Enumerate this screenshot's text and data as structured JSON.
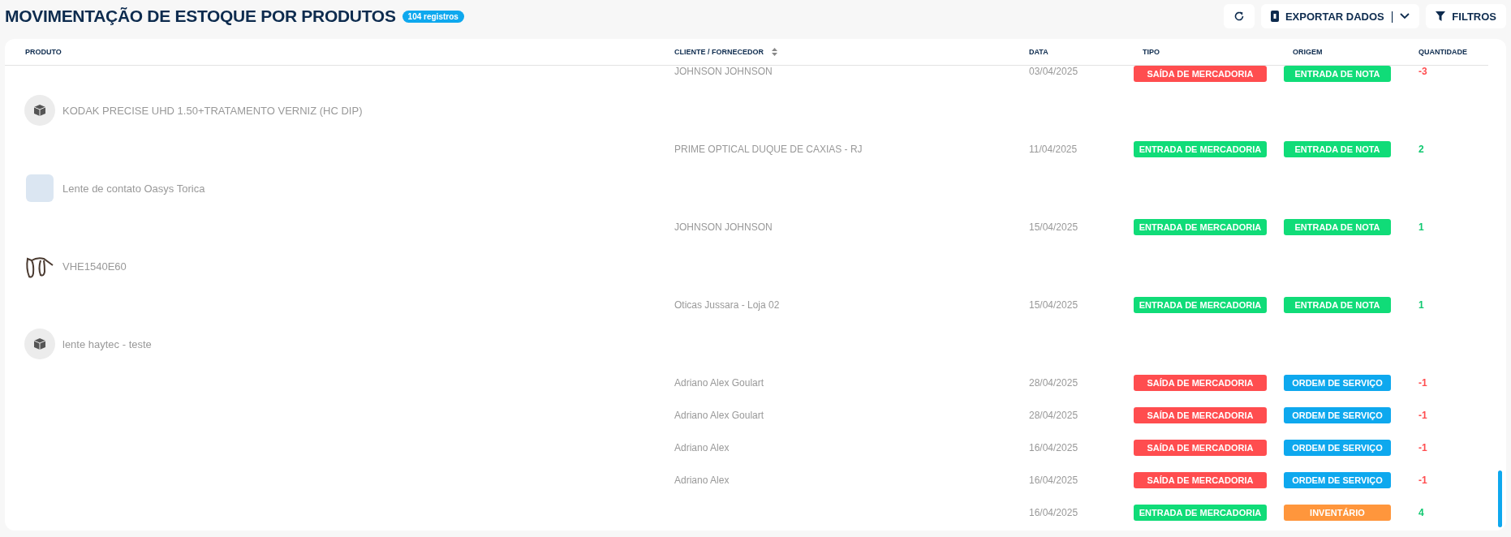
{
  "header": {
    "title": "MOVIMENTAÇÃO DE ESTOQUE POR PRODUTOS",
    "count_badge": "104 registros",
    "export_button": "EXPORTAR DADOS",
    "separator": "|",
    "filter_button": "FILTROS"
  },
  "table": {
    "columns": [
      "PRODUTO",
      "CLIENTE / FORNECEDOR",
      "DATA",
      "TIPO",
      "ORIGEM",
      "QUANTIDADE"
    ],
    "rows": [
      {
        "kind": "movement",
        "client": "JOHNSON JOHNSON",
        "date": "03/04/2025",
        "type": {
          "label": "SAÍDA DE MERCADORIA",
          "kind": "out"
        },
        "origin": {
          "label": "ENTRADA DE NOTA",
          "kind": "nota"
        },
        "quantity": "-3"
      },
      {
        "kind": "box",
        "name": "KODAK PRECISE UHD 1.50+TRATAMENTO VERNIZ (HC DIP)"
      },
      {
        "kind": "movement",
        "client": "PRIME OPTICAL DUQUE DE CAXIAS - RJ",
        "date": "11/04/2025",
        "type": {
          "label": "ENTRADA DE MERCADORIA",
          "kind": "in"
        },
        "origin": {
          "label": "ENTRADA DE NOTA",
          "kind": "nota"
        },
        "quantity": "2"
      },
      {
        "kind": "photo",
        "name": "Lente de contato Oasys Torica"
      },
      {
        "kind": "movement",
        "client": "JOHNSON JOHNSON",
        "date": "15/04/2025",
        "type": {
          "label": "ENTRADA DE MERCADORIA",
          "kind": "in"
        },
        "origin": {
          "label": "ENTRADA DE NOTA",
          "kind": "nota"
        },
        "quantity": "1"
      },
      {
        "kind": "glasses",
        "name": "VHE1540E60"
      },
      {
        "kind": "movement",
        "client": "Oticas Jussara - Loja 02",
        "date": "15/04/2025",
        "type": {
          "label": "ENTRADA DE MERCADORIA",
          "kind": "in"
        },
        "origin": {
          "label": "ENTRADA DE NOTA",
          "kind": "nota"
        },
        "quantity": "1"
      },
      {
        "kind": "box",
        "name": "lente haytec - teste"
      },
      {
        "kind": "movement",
        "client": "Adriano Alex Goulart",
        "date": "28/04/2025",
        "type": {
          "label": "SAÍDA DE MERCADORIA",
          "kind": "out"
        },
        "origin": {
          "label": "ORDEM DE SERVIÇO",
          "kind": "servico"
        },
        "quantity": "-1"
      },
      {
        "kind": "movement",
        "client": "Adriano Alex Goulart",
        "date": "28/04/2025",
        "type": {
          "label": "SAÍDA DE MERCADORIA",
          "kind": "out"
        },
        "origin": {
          "label": "ORDEM DE SERVIÇO",
          "kind": "servico"
        },
        "quantity": "-1"
      },
      {
        "kind": "movement",
        "client": "Adriano Alex",
        "date": "16/04/2025",
        "type": {
          "label": "SAÍDA DE MERCADORIA",
          "kind": "out"
        },
        "origin": {
          "label": "ORDEM DE SERVIÇO",
          "kind": "servico"
        },
        "quantity": "-1"
      },
      {
        "kind": "movement",
        "client": "Adriano Alex",
        "date": "16/04/2025",
        "type": {
          "label": "SAÍDA DE MERCADORIA",
          "kind": "out"
        },
        "origin": {
          "label": "ORDEM DE SERVIÇO",
          "kind": "servico"
        },
        "quantity": "-1"
      },
      {
        "kind": "movement",
        "date": "16/04/2025",
        "type": {
          "label": "ENTRADA DE MERCADORIA",
          "kind": "in"
        },
        "origin": {
          "label": "INVENTÁRIO",
          "kind": "inventario"
        },
        "quantity": "4"
      }
    ]
  }
}
